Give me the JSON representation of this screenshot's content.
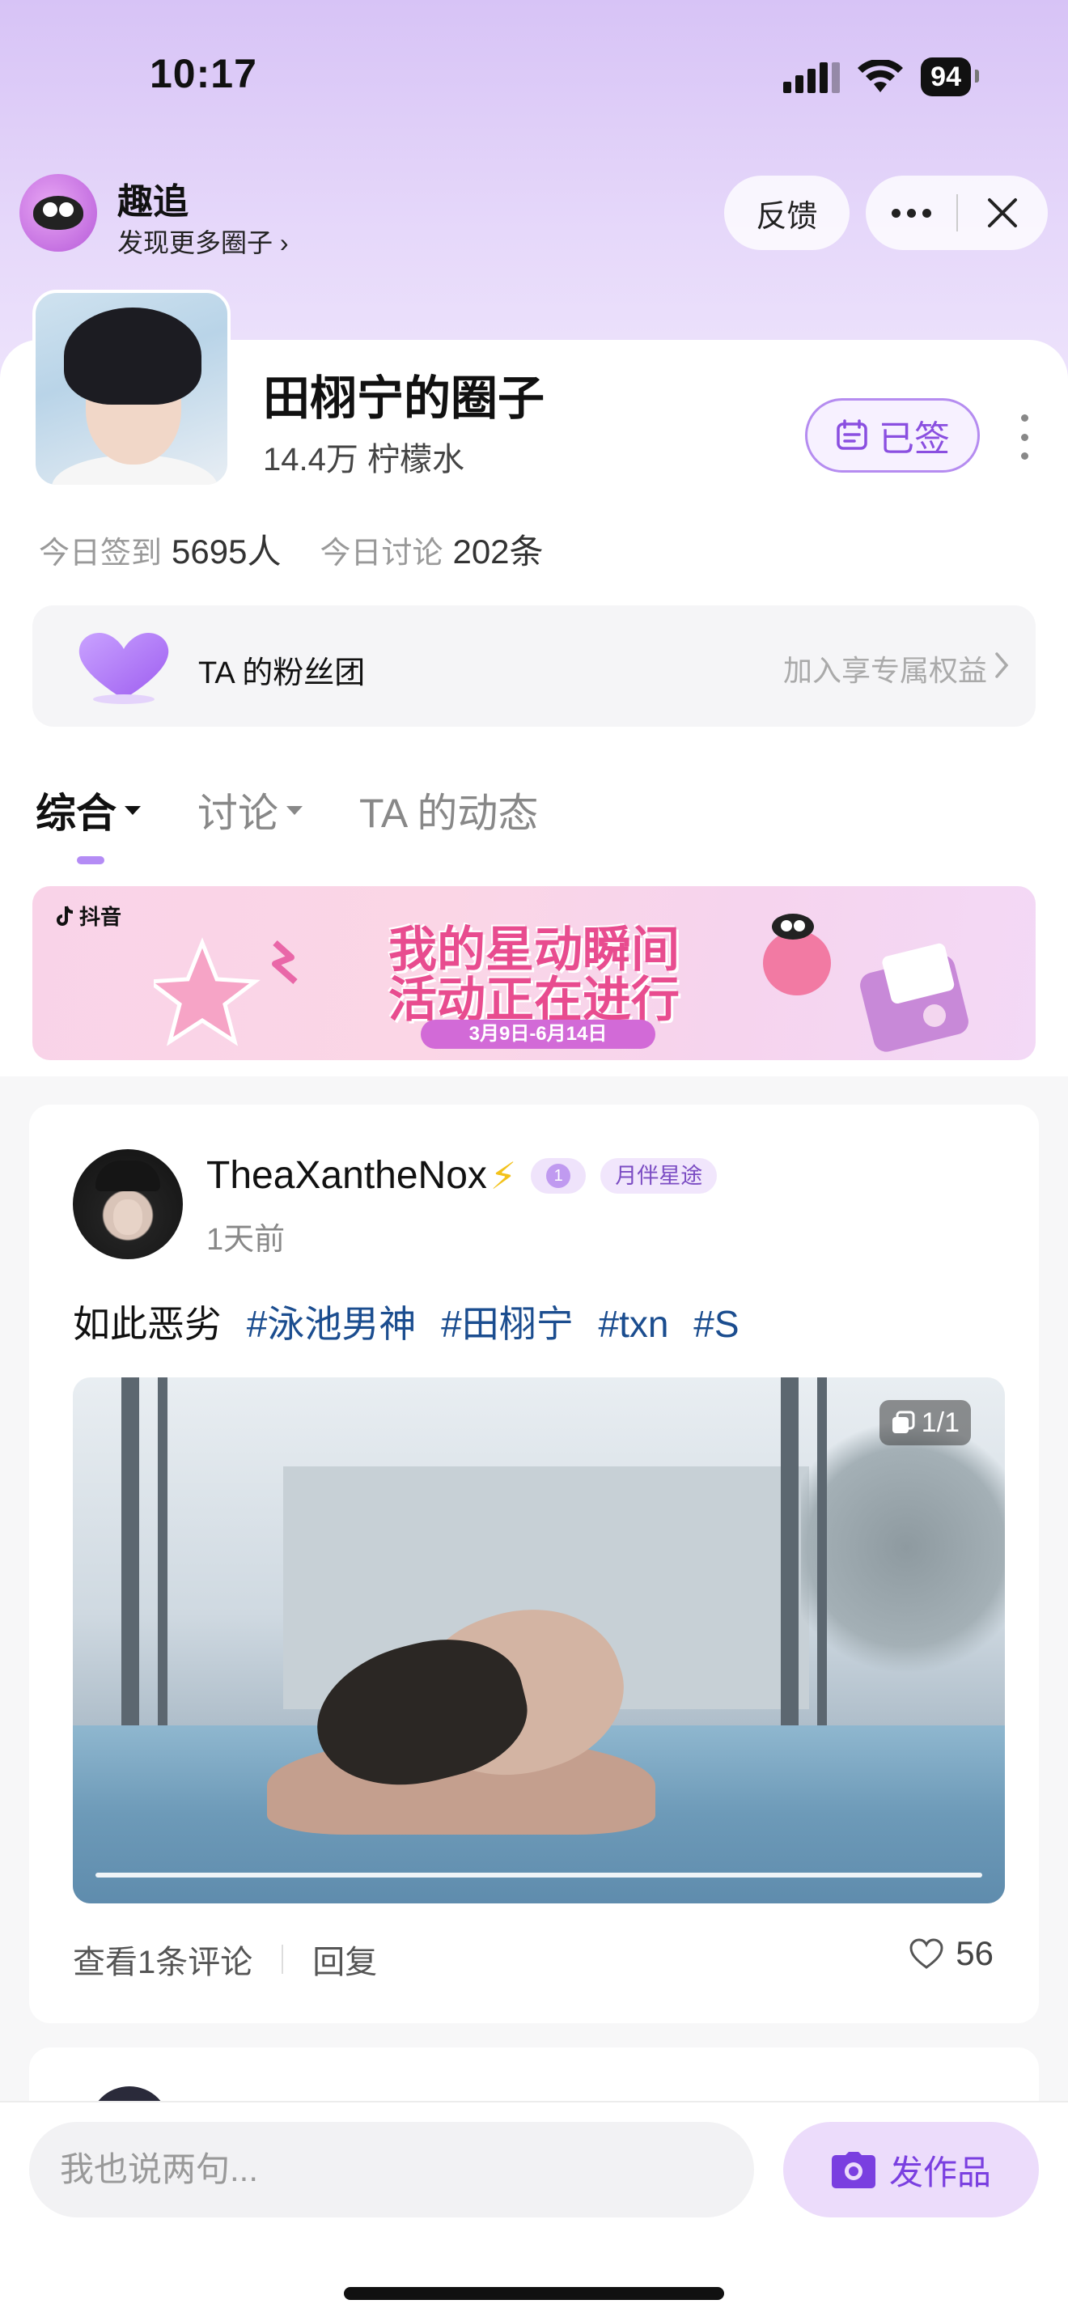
{
  "status_bar": {
    "time": "10:17",
    "battery": "94"
  },
  "app": {
    "name": "趣追",
    "subtitle": "发现更多圈子 ›",
    "feedback_label": "反馈"
  },
  "circle": {
    "title": "田栩宁的圈子",
    "subtitle": "14.4万 柠檬水",
    "signed_label": "已签",
    "stats": {
      "checkin_label": "今日签到",
      "checkin_value": "5695人",
      "discuss_label": "今日讨论",
      "discuss_value": "202条"
    }
  },
  "fan_club": {
    "label": "TA 的粉丝团",
    "action": "加入享专属权益"
  },
  "tabs": [
    {
      "label": "综合",
      "active": true,
      "dropdown": true
    },
    {
      "label": "讨论",
      "active": false,
      "dropdown": true
    },
    {
      "label": "TA 的动态",
      "active": false,
      "dropdown": false
    }
  ],
  "banner": {
    "brand": "抖音",
    "line1": "我的星动瞬间",
    "line2": "活动正在进行",
    "date": "3月9日-6月14日"
  },
  "post": {
    "username": "TheaXantheNox",
    "emoji": "⚡",
    "level": "1",
    "tag": "月伴星途",
    "time": "1天前",
    "text": "如此恶劣",
    "hashtags": [
      "#泳池男神",
      "#田栩宁",
      "#txn",
      "#S"
    ],
    "image_count": "1/1",
    "comments_label": "查看1条评论",
    "reply_label": "回复",
    "likes": "56"
  },
  "composer": {
    "placeholder": "我也说两句...",
    "publish_label": "发作品"
  },
  "colors": {
    "accent": "#8a4fe0",
    "hashtag": "#1b4d8f",
    "header_bg": "#d7c3f6"
  }
}
